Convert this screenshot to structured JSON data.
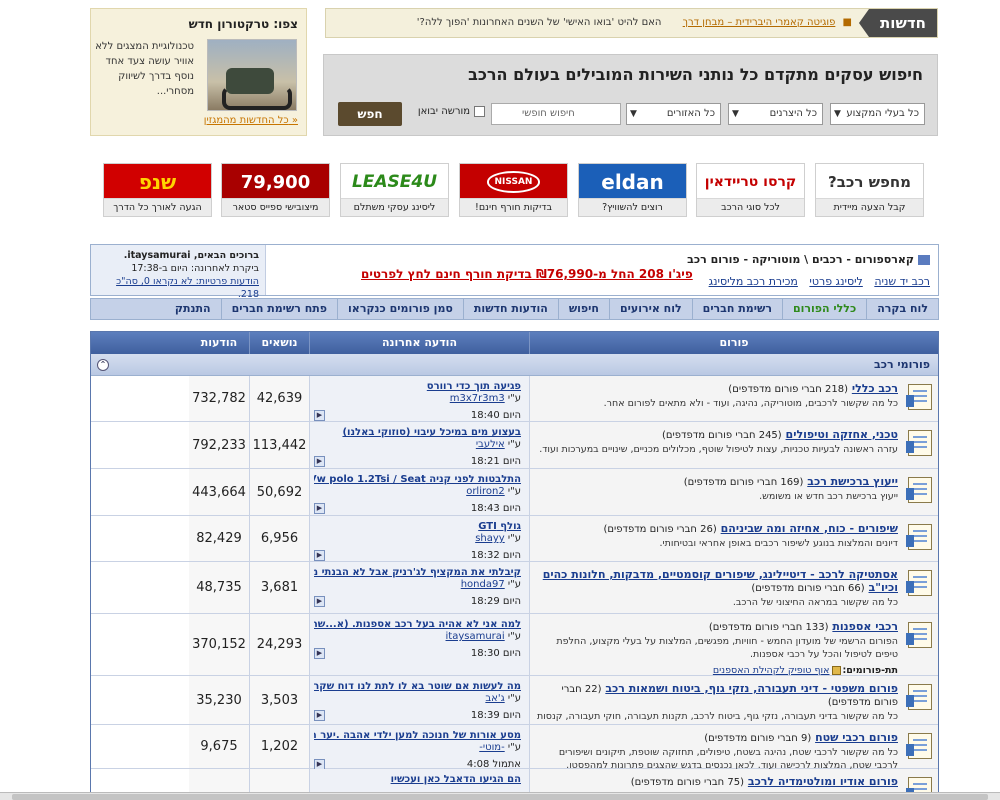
{
  "news": {
    "tag": "חדשות",
    "link": "פוגיטה קאמרי היברידית – מבחן דרך",
    "text": "האם להיט 'בואו האישי' של השנים האחרונות 'הפוך ללה?'"
  },
  "search": {
    "title": "חיפוש עסקים מתקדם כל נותני השירות המובילים בעולם הרכב",
    "field_business": "כל בעלי המקצוע",
    "field_make": "כל היצרנים",
    "field_region": "כל האזורים",
    "free_placeholder": "חיפוש חופשי",
    "checkbox_label": "מורשה יבואן",
    "button": "חפש"
  },
  "ad": {
    "title": "צפו: טרקטורון חדש",
    "body": "טכנולוגיית המצגים ללא אוויר עושה צעד אחד נוסף בדרך לשיווק מסחרי...",
    "all_news": "כל החדשות מהמגזין"
  },
  "banners": [
    {
      "logo": "מחפש רכב?",
      "caption": "קבל הצעה מיידית",
      "color": "#333333"
    },
    {
      "logo": "קרסו טריידאין",
      "caption": "לכל סוגי הרכב",
      "color": "#c40000"
    },
    {
      "logo": "eldan",
      "caption": "רוצים להשוויץ?",
      "color": "#1b5fb8"
    },
    {
      "logo": "NISSAN",
      "caption": "בדיקות חורף חינם!",
      "color": "#c40000"
    },
    {
      "logo": "LEASE4U",
      "caption": "ליסינג עסקי משתלם",
      "color": "#2c8a1a"
    },
    {
      "logo": "79,900",
      "caption": "מיצובישי ספייס סטאר",
      "color": "#a80000"
    },
    {
      "logo": "שנפ",
      "caption": "הגעה לאורך כל הדרך",
      "color": "#d10000"
    }
  ],
  "forum_header": {
    "breadcrumb": "קארספורום - רכבים \\ מוטוריקה - פורום רכב",
    "sublinks": [
      "רכב יד שניה",
      "ליסינג פרטי",
      "מכירת רכב מליסינג"
    ],
    "promo": "פיג'ו 208 החל מ-₪76,990 בדיקת חורף חינם לחץ לפרטים",
    "welcome_line1": "ברוכים הבאים, itaysamurai.",
    "welcome_line2": "ביקרת לאחרונה: היום ב-17:38",
    "welcome_line3": "הודעות פרטיות: לא נקראו 0, סה\"כ 218."
  },
  "nav": [
    "לוח בקרה",
    "כללי הפורום",
    "רשימת חברים",
    "לוח אירועים",
    "חיפוש",
    "הודעות חדשות",
    "סמן פורומים כנקראו",
    "פתח רשימת חברים",
    "התנתק"
  ],
  "table": {
    "headers": {
      "forum": "פורום",
      "last": "הודעה אחרונה",
      "topics": "נושאים",
      "posts": "הודעות"
    },
    "category": "פורומי רכב",
    "rows": [
      {
        "name": "רכב כללי",
        "count": "(218 חברי פורום מדפדפים)",
        "desc": "כל מה שקשור לרכבים, מוטוריקה, נהיגה, ועוד - ולא מתאים לפורום אחר.",
        "sub": "",
        "sublink": "",
        "lt": "פגיעה תוך כדי רוורס",
        "lb": "m3x7r3m3",
        "ld": "היום 18:40",
        "topics": "42,639",
        "posts": "732,782"
      },
      {
        "name": "טכני, אחזקה וטיפולים",
        "count": "(245 חברי פורום מדפדפים)",
        "desc": "עזרה ראשונה לבעיות טכניות, עצות לטיפול שוטף, מכלולים מכניים, שינויים במערכות ועוד.",
        "sub": "",
        "sublink": "",
        "lt": "בעצוע מים במיכל עיבוי (סוזוקי באלנו)",
        "lb": "אילעבי",
        "ld": "היום 18:21",
        "topics": "113,442",
        "posts": "792,233"
      },
      {
        "name": "ייעוץ ברכישת רכב",
        "count": "(169 חברי פורום מדפדפים)",
        "desc": "ייעוץ ברכישת רכב חדש או משומש.",
        "sub": "",
        "sublink": "",
        "lt": "התלבטות לפני קניה Vw polo 1.2Tsi / Seat",
        "lb": "orliron2",
        "ld": "היום 18:43",
        "topics": "50,692",
        "posts": "443,664"
      },
      {
        "name": "שיפורים - כוח, אחיזה ומה שביניהם",
        "count": "(26 חברי פורום מדפדפים)",
        "desc": "דיונים והמלצות בנוגע לשיפור רכבים באופן אחראי ובטיחותי.",
        "sub": "",
        "sublink": "",
        "lt": "גולף GTI",
        "lb": "shayy",
        "ld": "היום 18:32",
        "topics": "6,956",
        "posts": "82,429"
      },
      {
        "name": "אסתטיקה לרכב - דיטיילינג, שיפורים קוסמטיים, מדבקות, חלונות כהים וכיו\"ב",
        "count": "(66 חברי פורום מדפדפים)",
        "desc": "כל מה שקשור במראה החיצוני של הרכב.",
        "sub": "",
        "sublink": "",
        "lt": "קיבלתי את המקציף לג'רניק אבל לא הבנתי משהו...",
        "lb": "honda97",
        "ld": "היום 18:29",
        "topics": "3,681",
        "posts": "48,735"
      },
      {
        "name": "רכבי אספנות",
        "count": "(133 חברי פורום מדפדפים)",
        "desc": "הפורום הרשמי של מועדון החמש - חוויות, מפגשים, המלצות על בעלי מקצוע, החלפת טיפים לטיפול והכל על רכבי אספנות.",
        "sub": "תת-פורומים:",
        "sublink": "אוף טופיק לקהילת האספנים",
        "lt": "למה אני לא אהיה בעל רכב אספנות. (א...שרפו לי...",
        "lb": "itaysamurai",
        "ld": "היום 18:30",
        "topics": "24,293",
        "posts": "370,152"
      },
      {
        "name": "פורום משפטי - דיני תעבורה, נזקי גוף, ביטוח ושמאות רכב",
        "count": "(22 חברי פורום מדפדפים)",
        "desc": "כל מה שקשור בדיני תעבורה, נזקי גוף, ביטוח לרכב, תקנות תעבורה, חוקי תעבורה, קנסות תעבורה, מהירות מופרזת, נהיגה בשכרות, תאונות דרכים, התנהלות מול רשויות האכיפה וחברות הביטוח וכיוצא בזה.",
        "sub": "",
        "sublink": "",
        "lt": "מה לעשות אם שוטר בא לו לתת לנו דוח שקרי ?",
        "lb": "ג'אב",
        "ld": "היום 18:39",
        "topics": "3,503",
        "posts": "35,230"
      },
      {
        "name": "פורום רכבי שטח",
        "count": "(9 חברי פורום מדפדפים)",
        "desc": "כל מה שקשור לרכבי שטח, נהיגה בשטח, טיפולים, תחזוקה שוטפת, תיקונים ושיפורים לרכבי שטח, המלצות לרכישה ועוד. לכאן נכנסים בדגש שהצגים פתרונות למהפסטו.",
        "sub": "",
        "sublink": "",
        "lt": "מסע אורות של חנוכה למען ילדי אהבה .יער תל...",
        "lb": "-מוטי-",
        "ld": "אתמול 4:08",
        "topics": "1,202",
        "posts": "9,675"
      },
      {
        "name": "פורום אודיו ומולטימדיה לרכב",
        "count": "(75 חברי פורום מדפדפים)",
        "desc": "",
        "sub": "",
        "sublink": "",
        "lt": "הם הגיעו הדאבל כאן ועכשיו",
        "lb": "",
        "ld": "",
        "topics": "",
        "posts": ""
      }
    ]
  },
  "by_prefix": "ע\"י"
}
